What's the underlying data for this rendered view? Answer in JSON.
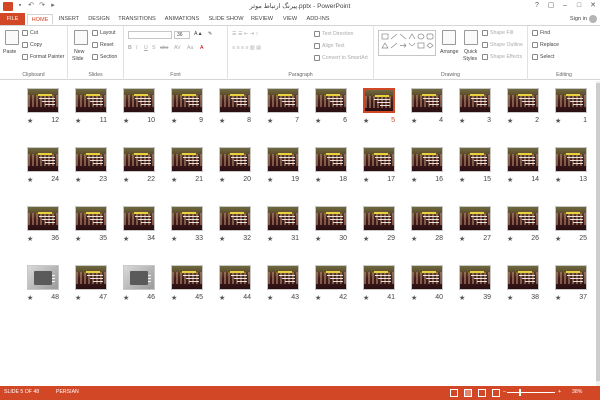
{
  "window": {
    "title": "پیرنگ ارتباط موثر.pptx - PowerPoint",
    "controls": [
      "?",
      "▢",
      "–",
      "□",
      "✕"
    ]
  },
  "qat_icons": [
    "save-icon",
    "undo-icon",
    "redo-icon",
    "start-slideshow-icon"
  ],
  "tabs": [
    {
      "label": "FILE"
    },
    {
      "label": "HOME"
    },
    {
      "label": "INSERT"
    },
    {
      "label": "DESIGN"
    },
    {
      "label": "TRANSITIONS"
    },
    {
      "label": "ANIMATIONS"
    },
    {
      "label": "SLIDE SHOW"
    },
    {
      "label": "REVIEW"
    },
    {
      "label": "VIEW"
    },
    {
      "label": "ADD-INS"
    }
  ],
  "signin": "Sign in",
  "ribbon": {
    "clipboard": {
      "label": "Clipboard",
      "paste": "Paste",
      "cut": "Cut",
      "copy": "Copy",
      "format_painter": "Format Painter"
    },
    "slides": {
      "label": "Slides",
      "new_slide": "New",
      "new_slide2": "Slide",
      "layout": "Layout",
      "reset": "Reset",
      "section": "Section"
    },
    "font": {
      "label": "Font",
      "font_name": "",
      "font_size": "36",
      "buttons": [
        "B",
        "I",
        "U",
        "S",
        "abc",
        "AV",
        "Aa",
        "A"
      ]
    },
    "paragraph": {
      "label": "Paragraph",
      "text_direction": "Text Direction",
      "align_text": "Align Text",
      "smartart": "Convert to SmartArt"
    },
    "drawing": {
      "label": "Drawing",
      "arrange": "Arrange",
      "quick_styles": "Quick",
      "quick_styles2": "Styles",
      "shape_fill": "Shape Fill",
      "shape_outline": "Shape Outline",
      "shape_effects": "Shape Effects"
    },
    "editing": {
      "label": "Editing",
      "find": "Find",
      "replace": "Replace",
      "select": "Select"
    }
  },
  "slides": [
    {
      "n": "1"
    },
    {
      "n": "2"
    },
    {
      "n": "3"
    },
    {
      "n": "4"
    },
    {
      "n": "5",
      "selected": true
    },
    {
      "n": "6"
    },
    {
      "n": "7"
    },
    {
      "n": "8"
    },
    {
      "n": "9"
    },
    {
      "n": "10"
    },
    {
      "n": "11"
    },
    {
      "n": "12"
    },
    {
      "n": "13"
    },
    {
      "n": "14"
    },
    {
      "n": "15"
    },
    {
      "n": "16"
    },
    {
      "n": "17"
    },
    {
      "n": "18"
    },
    {
      "n": "19"
    },
    {
      "n": "20"
    },
    {
      "n": "21"
    },
    {
      "n": "22"
    },
    {
      "n": "23"
    },
    {
      "n": "24"
    },
    {
      "n": "25"
    },
    {
      "n": "26"
    },
    {
      "n": "27"
    },
    {
      "n": "28"
    },
    {
      "n": "29"
    },
    {
      "n": "30"
    },
    {
      "n": "31"
    },
    {
      "n": "32"
    },
    {
      "n": "33"
    },
    {
      "n": "34"
    },
    {
      "n": "35"
    },
    {
      "n": "36"
    },
    {
      "n": "37"
    },
    {
      "n": "38"
    },
    {
      "n": "39"
    },
    {
      "n": "40"
    },
    {
      "n": "41"
    },
    {
      "n": "42"
    },
    {
      "n": "43"
    },
    {
      "n": "44"
    },
    {
      "n": "45"
    },
    {
      "n": "46",
      "photo": true
    },
    {
      "n": "47"
    },
    {
      "n": "48",
      "photo": true
    }
  ],
  "status": {
    "slide_info": "SLIDE 5 OF 48",
    "language": "PERSIAN",
    "zoom": "38%"
  },
  "colors": {
    "accent": "#d24726"
  }
}
